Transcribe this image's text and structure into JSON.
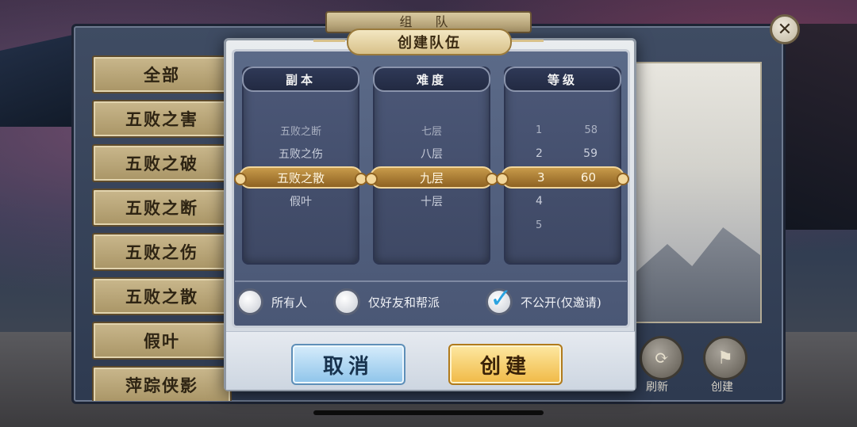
{
  "team_window": {
    "title": "组 队",
    "categories": [
      "全部",
      "五败之害",
      "五败之破",
      "五败之断",
      "五败之伤",
      "五败之散",
      "假叶",
      "萍踪侠影"
    ],
    "refresh_label": "刷新",
    "create_label": "创建",
    "close_symbol": "✕"
  },
  "dialog": {
    "title": "创建队伍",
    "columns": {
      "dungeon": {
        "header": "副本",
        "rows": [
          "五败之断",
          "五败之伤",
          "五败之散",
          "假叶"
        ],
        "selected": "五败之散"
      },
      "difficulty": {
        "header": "难度",
        "rows": [
          "七层",
          "八层",
          "九层",
          "十层"
        ],
        "selected": "九层"
      },
      "level": {
        "header": "等级",
        "min_values": [
          "1",
          "2",
          "3",
          "4",
          "5"
        ],
        "max_values": [
          "58",
          "59",
          "60"
        ],
        "selected_min": "3",
        "selected_max": "60"
      }
    },
    "visibility": {
      "options": [
        "所有人",
        "仅好友和帮派",
        "不公开(仅邀请)"
      ],
      "selected": "不公开(仅邀请)"
    },
    "cancel_label": "取消",
    "confirm_label": "创建"
  },
  "colors": {
    "selection_gold": "#c79a4a",
    "cancel_blue": "#8ec4ea",
    "create_gold": "#f0b945",
    "check_blue": "#2aa3e0"
  },
  "icons": {
    "close": "close-icon",
    "refresh": "refresh-icon",
    "create": "flag-icon",
    "check": "checkmark-icon"
  }
}
